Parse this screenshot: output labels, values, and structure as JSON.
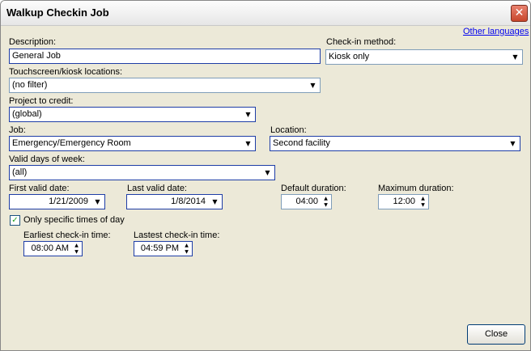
{
  "window": {
    "title": "Walkup Checkin Job",
    "close_glyph": "✕"
  },
  "links": {
    "other_languages": "Other languages"
  },
  "description": {
    "label": "Description:",
    "value": "General Job"
  },
  "checkin_method": {
    "label": "Check-in method:",
    "value": "Kiosk only"
  },
  "locations": {
    "label": "Touchscreen/kiosk locations:",
    "value": "(no filter)"
  },
  "project": {
    "label": "Project to credit:",
    "value": "(global)"
  },
  "job": {
    "label": "Job:",
    "value": "Emergency/Emergency Room"
  },
  "location": {
    "label": "Location:",
    "value": "Second facility"
  },
  "valid_days": {
    "label": "Valid days of week:",
    "value": "(all)"
  },
  "first_valid_date": {
    "label": "First valid date:",
    "value": "1/21/2009"
  },
  "last_valid_date": {
    "label": "Last valid date:",
    "value": "1/8/2014"
  },
  "default_duration": {
    "label": "Default duration:",
    "value": "04:00"
  },
  "maximum_duration": {
    "label": "Maximum duration:",
    "value": "12:00"
  },
  "specific_times": {
    "label": "Only specific times of day",
    "checked": true
  },
  "earliest_checkin": {
    "label": "Earliest check-in time:",
    "value": "08:00 AM"
  },
  "latest_checkin": {
    "label": "Lastest check-in time:",
    "value": "04:59 PM"
  },
  "buttons": {
    "close": "Close"
  },
  "icons": {
    "dropdown": "▼",
    "spin_up": "▲",
    "spin_down": "▼",
    "check": "✓"
  }
}
